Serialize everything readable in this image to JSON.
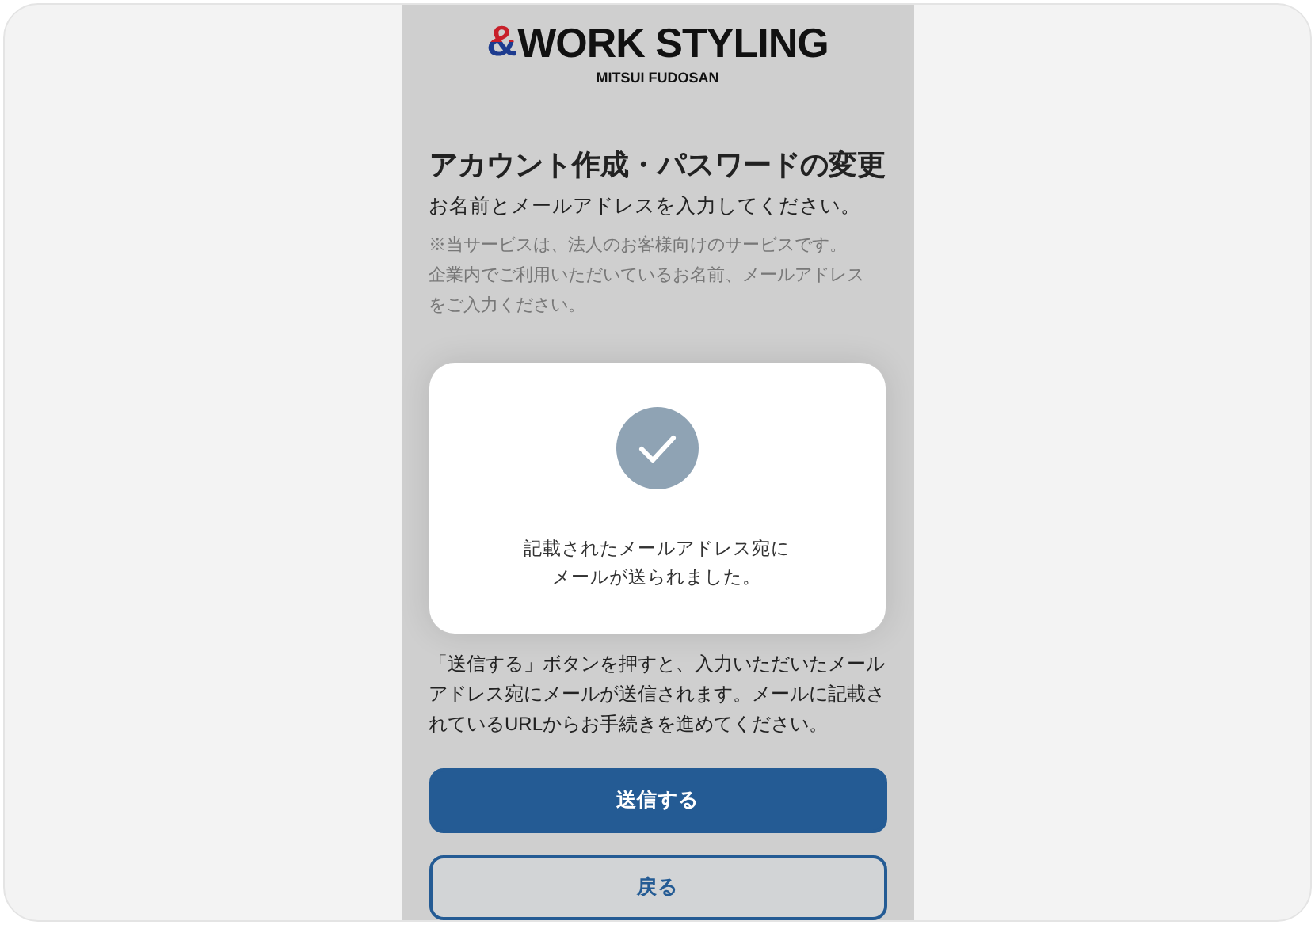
{
  "logo": {
    "mark": "&",
    "wordmark": "WORK STYLING",
    "company": "MITSUI FUDOSAN"
  },
  "title": "アカウント作成・パスワードの変更",
  "lead": "お名前とメールアドレスを入力してください。",
  "note": [
    "※当サービスは、法人のお客様向けのサービスです。",
    "企業内でご利用いただいているお名前、メールアドレスをご入力ください。"
  ],
  "modal": {
    "message": "記載されたメールアドレス宛にメールが送られました。"
  },
  "instructions": "「送信する」ボタンを押すと、入力いただいたメールアドレス宛にメールが送信されます。メールに記載されているURLからお手続きを進めてください。",
  "buttons": [
    {
      "label": "送信する",
      "kind": "primary"
    },
    {
      "label": "戻る",
      "kind": "secondary"
    }
  ]
}
